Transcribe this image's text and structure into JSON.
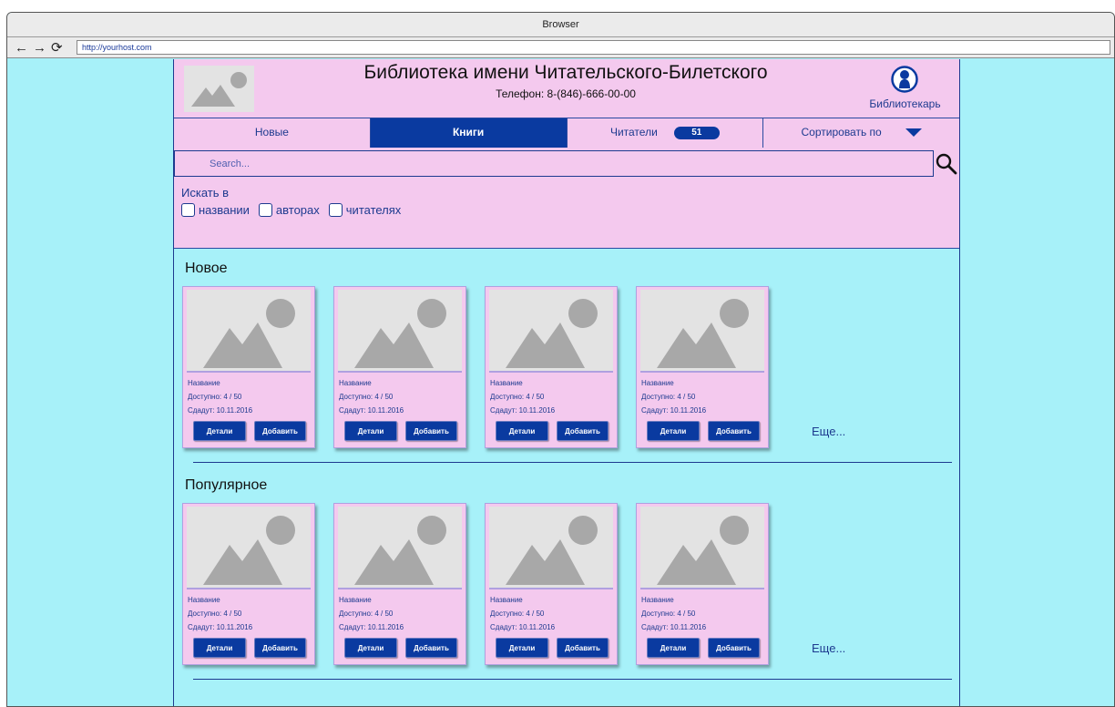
{
  "browser": {
    "title": "Browser",
    "nav": {
      "back": "←",
      "forward": "→",
      "reload": "⟳"
    },
    "url": "http://yourhost.com"
  },
  "header": {
    "title": "Библиотека имени Читательского-Билетского",
    "phone": "Телефон: 8-(846)-666-00-00",
    "user_label": "Библиотекарь"
  },
  "tabs": [
    {
      "label": "Новые",
      "active": false
    },
    {
      "label": "Книги",
      "active": true
    },
    {
      "label": "Читатели",
      "badge": "51",
      "active": false
    },
    {
      "label": "Сортировать по",
      "active": false
    }
  ],
  "search": {
    "placeholder": "Search...",
    "search_in_label": "Искать в",
    "filters": [
      "названии",
      "авторах",
      "читателях"
    ]
  },
  "sections": [
    {
      "title": "Новое",
      "more": "Еще...",
      "cards": [
        {
          "name": "Название",
          "available": "Доступно: 4 / 50",
          "due": "Сдадут: 10.11.2016",
          "details": "Детали",
          "add": "Добавить"
        },
        {
          "name": "Название",
          "available": "Доступно: 4 / 50",
          "due": "Сдадут: 10.11.2016",
          "details": "Детали",
          "add": "Добавить"
        },
        {
          "name": "Название",
          "available": "Доступно: 4 / 50",
          "due": "Сдадут: 10.11.2016",
          "details": "Детали",
          "add": "Добавить"
        },
        {
          "name": "Название",
          "available": "Доступно: 4 / 50",
          "due": "Сдадут: 10.11.2016",
          "details": "Детали",
          "add": "Добавить"
        }
      ]
    },
    {
      "title": "Популярное",
      "more": "Еще...",
      "cards": [
        {
          "name": "Название",
          "available": "Доступно: 4 / 50",
          "due": "Сдадут: 10.11.2016",
          "details": "Детали",
          "add": "Добавить"
        },
        {
          "name": "Название",
          "available": "Доступно: 4 / 50",
          "due": "Сдадут: 10.11.2016",
          "details": "Детали",
          "add": "Добавить"
        },
        {
          "name": "Название",
          "available": "Доступно: 4 / 50",
          "due": "Сдадут: 10.11.2016",
          "details": "Детали",
          "add": "Добавить"
        },
        {
          "name": "Название",
          "available": "Доступно: 4 / 50",
          "due": "Сдадут: 10.11.2016",
          "details": "Детали",
          "add": "Добавить"
        }
      ]
    }
  ],
  "colors": {
    "page_bg": "#a7f1f9",
    "panel_bg": "#f4c9ee",
    "accent": "#0a3aa0",
    "placeholder_gray": "#e3e3e3",
    "icon_gray": "#a8a8a8"
  }
}
